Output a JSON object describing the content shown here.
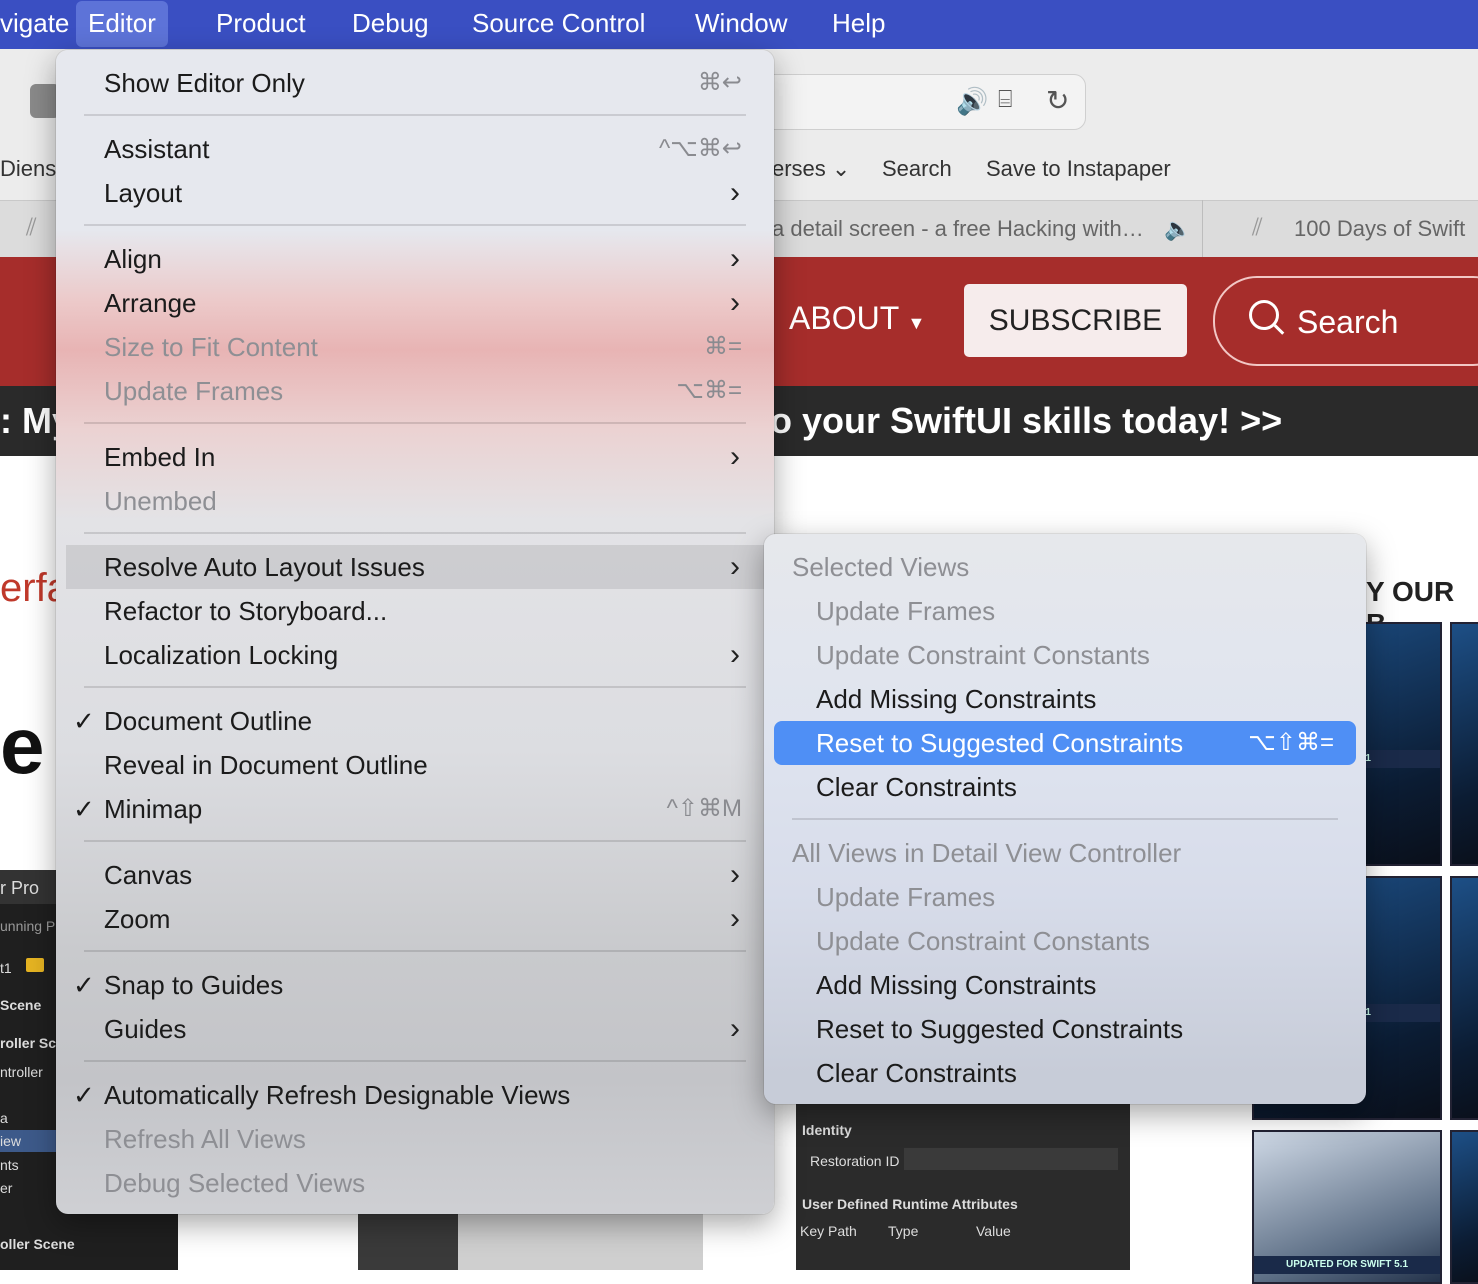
{
  "menubar": {
    "items": [
      "vigate",
      "Editor",
      "Product",
      "Debug",
      "Source Control",
      "Window",
      "Help"
    ]
  },
  "browser": {
    "bookmarks": [
      "Diens",
      "erses",
      "Search",
      "Save to Instapaper"
    ],
    "tabs": [
      "a detail screen - a free Hacking with…",
      "100 Days of Swift"
    ]
  },
  "site": {
    "nav_about": "ABOUT",
    "subscribe": "SUBSCRIBE",
    "search": "Search",
    "banner_left": ": My",
    "banner_right": "o your SwiftUI skills today! >>",
    "side_text_1": "erfa",
    "side_text_2": "e",
    "side_heading": "Y OUR B",
    "cover_tag": "SWIFT 5.1",
    "cover_tag_3": "UPDATED FOR SWIFT 5.1"
  },
  "ide": {
    "left_lines": [
      "r  Pro",
      "unning Pr",
      "t1",
      "Scene",
      "roller Sc",
      "ntroller",
      "a",
      "iew",
      "nts",
      "er",
      "oller Scene"
    ],
    "identity": "Identity",
    "restoration_id": "Restoration ID",
    "user_defined": "User Defined Runtime Attributes",
    "col_key_path": "Key Path",
    "col_type": "Type",
    "col_value": "Value"
  },
  "editor_menu": {
    "items": [
      {
        "label": "Show Editor Only",
        "shortcut": "⌘↩",
        "enabled": true
      },
      {
        "label": "Assistant",
        "shortcut": "^⌥⌘↩",
        "enabled": true
      },
      {
        "label": "Layout",
        "enabled": true,
        "submenu": true
      },
      {
        "label": "Align",
        "enabled": true,
        "submenu": true
      },
      {
        "label": "Arrange",
        "enabled": true,
        "submenu": true
      },
      {
        "label": "Size to Fit Content",
        "shortcut": "⌘=",
        "enabled": false
      },
      {
        "label": "Update Frames",
        "shortcut": "⌥⌘=",
        "enabled": false
      },
      {
        "label": "Embed In",
        "enabled": true,
        "submenu": true
      },
      {
        "label": "Unembed",
        "enabled": false
      },
      {
        "label": "Resolve Auto Layout Issues",
        "enabled": true,
        "submenu": true,
        "highlighted": true
      },
      {
        "label": "Refactor to Storyboard...",
        "enabled": true
      },
      {
        "label": "Localization Locking",
        "enabled": true,
        "submenu": true
      },
      {
        "label": "Document Outline",
        "enabled": true,
        "checked": true
      },
      {
        "label": "Reveal in Document Outline",
        "enabled": true
      },
      {
        "label": "Minimap",
        "shortcut": "^⇧⌘M",
        "enabled": true,
        "checked": true
      },
      {
        "label": "Canvas",
        "enabled": true,
        "submenu": true
      },
      {
        "label": "Zoom",
        "enabled": true,
        "submenu": true
      },
      {
        "label": "Snap to Guides",
        "enabled": true,
        "checked": true
      },
      {
        "label": "Guides",
        "enabled": true,
        "submenu": true
      },
      {
        "label": "Automatically Refresh Designable Views",
        "enabled": true,
        "checked": true
      },
      {
        "label": "Refresh All Views",
        "enabled": false
      },
      {
        "label": "Debug Selected Views",
        "enabled": false
      }
    ]
  },
  "submenu": {
    "section1": "Selected Views",
    "section2": "All Views in Detail View Controller",
    "items1": [
      {
        "label": "Update Frames",
        "enabled": false
      },
      {
        "label": "Update Constraint Constants",
        "enabled": false
      },
      {
        "label": "Add Missing Constraints",
        "enabled": true
      },
      {
        "label": "Reset to Suggested Constraints",
        "shortcut": "⌥⇧⌘=",
        "enabled": true,
        "highlighted": true
      },
      {
        "label": "Clear Constraints",
        "enabled": true
      }
    ],
    "items2": [
      {
        "label": "Update Frames",
        "enabled": false
      },
      {
        "label": "Update Constraint Constants",
        "enabled": false
      },
      {
        "label": "Add Missing Constraints",
        "enabled": true
      },
      {
        "label": "Reset to Suggested Constraints",
        "enabled": true
      },
      {
        "label": "Clear Constraints",
        "enabled": true
      }
    ]
  },
  "colors": {
    "menubar": "#3a4fc2",
    "site_red": "#a62d2b",
    "highlight_blue": "#4f8ff5"
  }
}
